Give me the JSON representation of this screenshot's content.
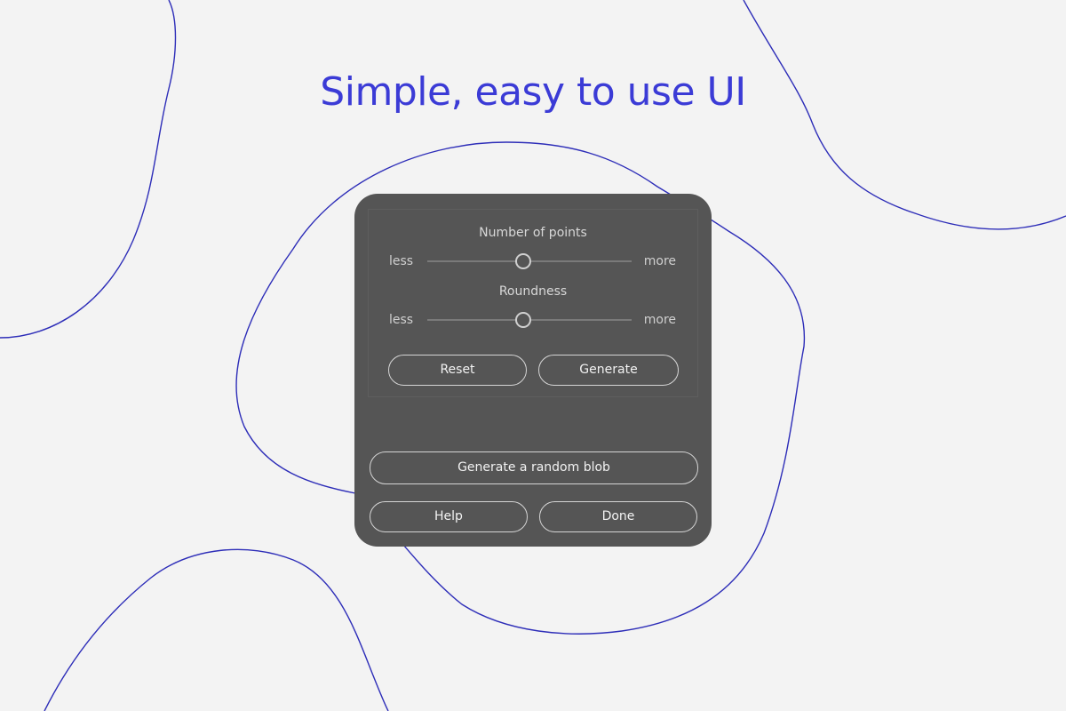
{
  "headline": "Simple, easy to use UI",
  "colors": {
    "accent": "#3b3bd6",
    "line": "#2d2db8",
    "panel": "#555555",
    "background": "#f3f3f3"
  },
  "panel": {
    "sliders": [
      {
        "title": "Number of points",
        "left_label": "less",
        "right_label": "more",
        "value_percent": 47
      },
      {
        "title": "Roundness",
        "left_label": "less",
        "right_label": "more",
        "value_percent": 47
      }
    ],
    "buttons": {
      "reset": "Reset",
      "generate": "Generate",
      "random_blob": "Generate a random blob",
      "help": "Help",
      "done": "Done"
    }
  }
}
